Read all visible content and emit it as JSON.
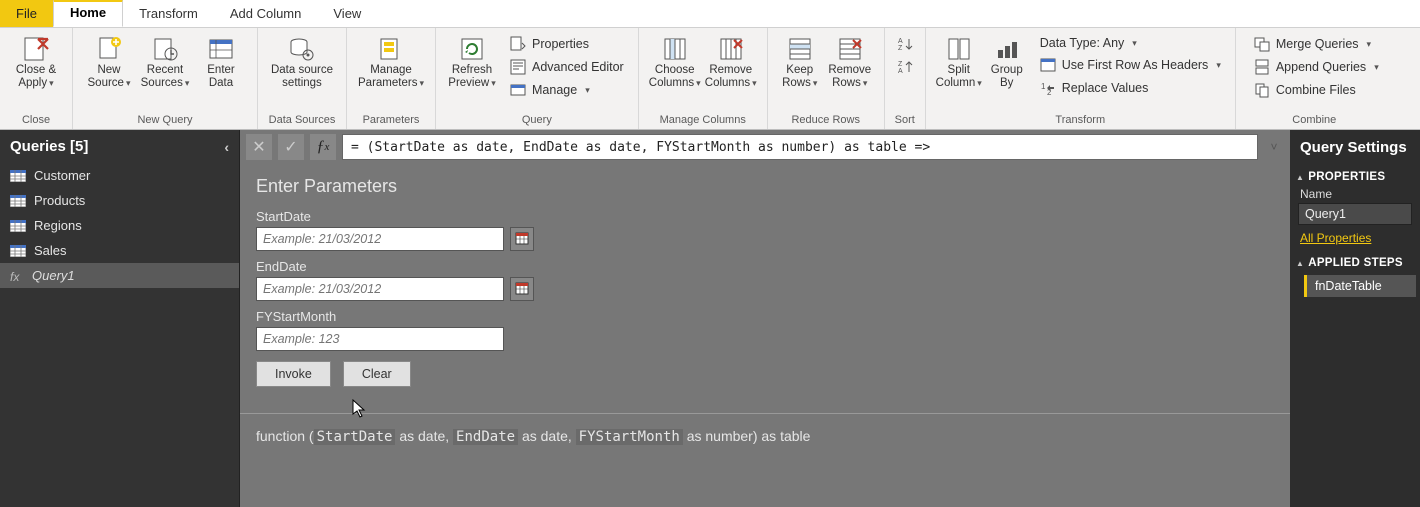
{
  "tabs": {
    "file": "File",
    "home": "Home",
    "transform": "Transform",
    "addcol": "Add Column",
    "view": "View"
  },
  "ribbon": {
    "close": {
      "line1": "Close &",
      "line2": "Apply",
      "group": "Close"
    },
    "newquery": {
      "newsrc1": "New",
      "newsrc2": "Source",
      "recent1": "Recent",
      "recent2": "Sources",
      "enter1": "Enter",
      "enter2": "Data",
      "group": "New Query"
    },
    "datasources": {
      "line1": "Data source",
      "line2": "settings",
      "group": "Data Sources"
    },
    "params": {
      "line1": "Manage",
      "line2": "Parameters",
      "group": "Parameters"
    },
    "query": {
      "refresh1": "Refresh",
      "refresh2": "Preview",
      "props": "Properties",
      "adv": "Advanced Editor",
      "manage": "Manage",
      "group": "Query"
    },
    "managecols": {
      "choose1": "Choose",
      "choose2": "Columns",
      "remove1": "Remove",
      "remove2": "Columns",
      "group": "Manage Columns"
    },
    "reducerows": {
      "keep1": "Keep",
      "keep2": "Rows",
      "remove1": "Remove",
      "remove2": "Rows",
      "group": "Reduce Rows"
    },
    "sort": {
      "group": "Sort"
    },
    "transform": {
      "split1": "Split",
      "split2": "Column",
      "group1": "Group",
      "group2": "By",
      "dt": "Data Type: Any",
      "first": "Use First Row As Headers",
      "replace": "Replace Values",
      "group": "Transform"
    },
    "combine": {
      "merge": "Merge Queries",
      "append": "Append Queries",
      "files": "Combine Files",
      "group": "Combine"
    }
  },
  "queries": {
    "header": "Queries [5]",
    "items": [
      "Customer",
      "Products",
      "Regions",
      "Sales",
      "Query1"
    ]
  },
  "formula": "= (StartDate as date, EndDate as date, FYStartMonth as number) as table =>",
  "params_panel": {
    "title": "Enter Parameters",
    "start_label": "StartDate",
    "end_label": "EndDate",
    "fy_label": "FYStartMonth",
    "date_ph": "Example: 21/03/2012",
    "num_ph": "Example: 123",
    "invoke": "Invoke",
    "clear": "Clear"
  },
  "signature_html": "function (<span class='mono'>StartDate</span> as date, <span class='mono'>EndDate</span> as date, <span class='mono'>FYStartMonth</span> as number) as table",
  "signature_plain": "function (StartDate as date, EndDate as date, FYStartMonth as number) as table",
  "settings": {
    "header": "Query Settings",
    "props": "PROPERTIES",
    "name_label": "Name",
    "name_value": "Query1",
    "all_props": "All Properties",
    "steps": "APPLIED STEPS",
    "step0": "fnDateTable"
  }
}
